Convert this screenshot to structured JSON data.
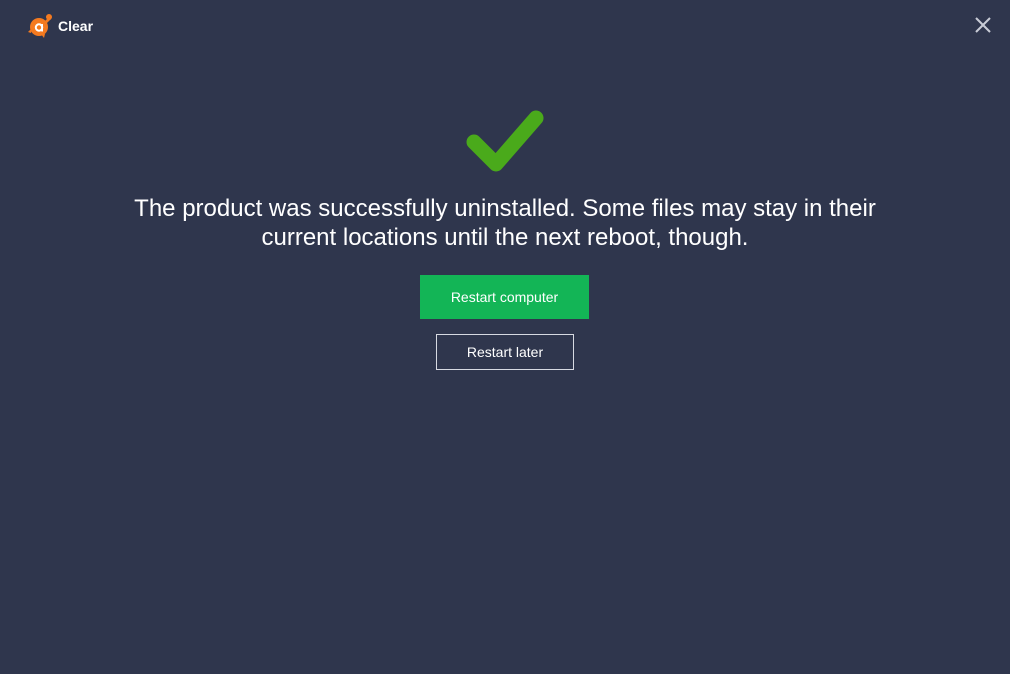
{
  "window": {
    "app_title": "Clear",
    "logo_icon": "avast-logo-icon",
    "close_icon": "close-icon"
  },
  "main": {
    "status_icon": "checkmark-icon",
    "message": "The product was successfully uninstalled. Some files may stay in their current locations until the next reboot, though.",
    "primary_button_label": "Restart computer",
    "secondary_button_label": "Restart later"
  },
  "colors": {
    "background": "#2f364d",
    "accent_green": "#13b556",
    "check_green": "#4aaa1b",
    "logo_orange": "#f47a20",
    "text": "#ffffff"
  }
}
